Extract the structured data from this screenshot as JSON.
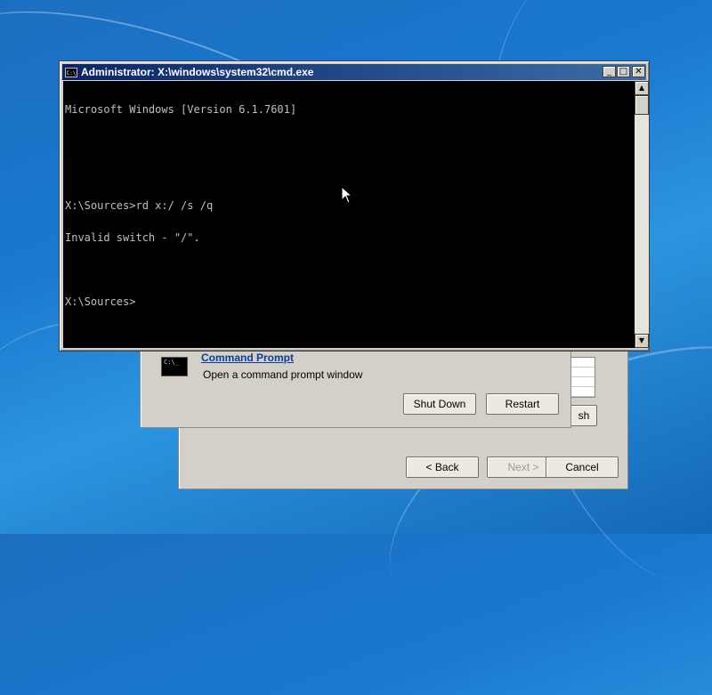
{
  "cmd_window": {
    "title": "Administrator: X:\\windows\\system32\\cmd.exe",
    "icon_text": "C:\\",
    "console_lines": [
      "Microsoft Windows [Version 6.1.7601]",
      "",
      "",
      "X:\\Sources>rd x:/ /s /q",
      "Invalid switch - \"/\".",
      "",
      "X:\\Sources>"
    ],
    "minimize_glyph": "_",
    "maximize_glyph": "□",
    "close_glyph": "✕",
    "scroll_up_glyph": "▲",
    "scroll_down_glyph": "▼"
  },
  "recovery_window": {
    "thumb_text": "C:\\_",
    "link_label": "Command Prompt",
    "description": "Open a command prompt window",
    "shutdown_label": "Shut Down",
    "restart_label": "Restart",
    "partial_button_label": "sh"
  },
  "wizard_window": {
    "back_label": "< Back",
    "next_label": "Next >",
    "cancel_label": "Cancel"
  },
  "colors": {
    "desktop": "#1a78cf",
    "titlebar_start": "#0a246a",
    "titlebar_end": "#3a6ea5",
    "console_bg": "#000000",
    "console_text": "#c0c0c0",
    "link": "#0b3c9e"
  }
}
